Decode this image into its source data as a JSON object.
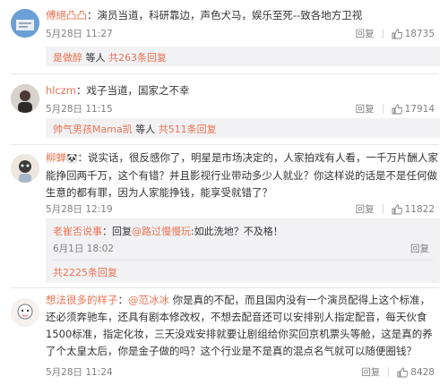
{
  "comments": [
    {
      "user": "傅絕凸凸",
      "sep": "：",
      "text": "演员当道，科研靠边，声色犬马，娱乐至死--致各地方卫视",
      "date": "5月28日 11:27",
      "reply_label": "回复",
      "likes": "18735",
      "replies": {
        "user": "是做醉",
        "middle": " 等人 ",
        "count_link": "共263条回复"
      }
    },
    {
      "user": "hlczm",
      "sep": "：",
      "text": "戏子当道，国家之不幸",
      "date": "5月28日 11:15",
      "reply_label": "回复",
      "likes": "17914",
      "replies": {
        "user": "帅气男孩Mama凯",
        "middle": " 等人 ",
        "count_link": "共511条回复"
      }
    },
    {
      "user": "柳蝉",
      "badge": "🐼",
      "sep": "：",
      "text": "说实话，很反感你了，明星是市场决定的，人家拍戏有人看，一千万片酬人家能挣回两千万，这个有错？并且影视行业带动多少人就业？你这样说的话是不是任何做生意的都有罪，因为人家能挣钱，能享受就错了？",
      "date": "5月28日 12:19",
      "reply_label": "回复",
      "likes": "11822",
      "sub_reply": {
        "user": "老崔否说事",
        "sep": "：",
        "prefix": "回复",
        "mention": "@路过慢慢玩",
        "text": ":如此洗地？不及格！",
        "date": "6月1日 18:02",
        "reply_label": "回复"
      },
      "replies_total": "共2225条回复"
    },
    {
      "user": "想法很多的样子",
      "sep": "：",
      "mention": "@范冰冰",
      "text": " 你是真的不配，而且国内没有一个演员配得上这个标准，还必须奔驰车，还具有剧本修改权，不想去配音还可以安排别人指定配音，每天伙食1500标准，指定化妆，三天没戏安排就要让剧组给你买回京机票头等舱，这是真的养了个太皇太后，你是金子做的吗？这个行业是不是真的混点名气就可以随便圈钱？",
      "date": "5月28日 11:24",
      "reply_label": "回复",
      "likes": "8428"
    }
  ],
  "colors": {
    "link": "#eb7350",
    "meta": "#808080",
    "subbox": "#f2f2f5"
  },
  "icons": {
    "like": "thumb-up-icon"
  }
}
